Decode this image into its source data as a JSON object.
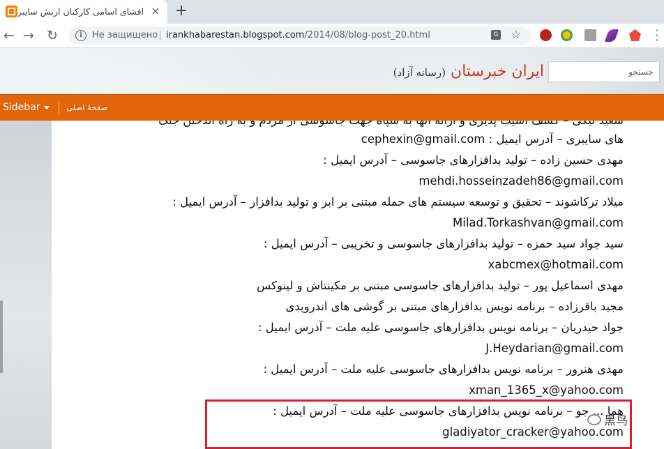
{
  "browser": {
    "tab_title": "افشای اسامی کارکنان ارتش سایبری",
    "tab_close": "×",
    "new_tab": "+",
    "not_secure_label": "Не защищено",
    "url_host": "irankhabarestan.blogspot.com",
    "url_path": "/2014/08/blog-post_20.html",
    "icons": [
      "blogger-favicon-icon",
      "back-arrow-icon",
      "forward-arrow-icon",
      "reload-icon",
      "info-icon",
      "translate-icon",
      "star-icon",
      "menu-icon"
    ]
  },
  "header": {
    "search_placeholder": "جستجو",
    "site_title": "ایران خبرستان",
    "site_subtitle": "(رسانه آزاد)"
  },
  "nav": {
    "sidebar_label": "Sidebar",
    "home_label": "صفحهٔ اصلی"
  },
  "content": {
    "lines": [
      {
        "text": "سعید لیکی – کشف آسیب پذیری و ارائه آنها به سپاه جهت جاسوسی از مردم و به راه اندختن جنگ",
        "type": "fa"
      },
      {
        "text": "های سایبری – آدرس ایمیل : cephexin@gmail.com",
        "type": "fa"
      },
      {
        "text": "مهدی حسین زاده –  تولید بدافزارهای جاسوسی – آدرس ایمیل :",
        "type": "fa"
      },
      {
        "text": "mehdi.hosseinzadeh86@gmail.com",
        "type": "em"
      },
      {
        "text": "میلاد ترکاشوند – تحقیق و توسعه سیستم های حمله مبتنی بر ابر و تولید بدافزار – آدرس ایمیل :",
        "type": "fa"
      },
      {
        "text": "Milad.Torkashvan@gmail.com",
        "type": "em"
      },
      {
        "text": "سید جواد سید حمزه – تولید بدافزارهای جاسوسی و تخریبی – آدرس ایمیل :",
        "type": "fa"
      },
      {
        "text": "xabcmex@hotmail.com",
        "type": "em"
      },
      {
        "text": "مهدی اسماعیل پور – تولید بدافزارهای جاسوسی مبتنی بر مکینتاش و لینوکس",
        "type": "fa"
      },
      {
        "text": "مجید باقرزاده – برنامه نویس بدافزارهای مبتنی بر گوشی های اندرویدی",
        "type": "fa"
      },
      {
        "text": "جواد حیدریان – برنامه نویس بدافزارهای جاسوسی علیه ملت – آدرس ایمیل :",
        "type": "fa"
      },
      {
        "text": "J.Heydarian@gmail.com",
        "type": "em"
      },
      {
        "text": "مهدی هنرور – برنامه نویس بدافزارهای جاسوسی علیه ملت – آدرس ایمیل :",
        "type": "fa"
      },
      {
        "text": "xman_1365_x@yahoo.com",
        "type": "em"
      },
      {
        "text": "هما ... جو – برنامه نویس بدافزارهای جاسوسی علیه ملت – آدرس ایمیل :",
        "type": "fa"
      },
      {
        "text": "gladiyator_cracker@yahoo.com",
        "type": "em"
      }
    ]
  },
  "watermark": {
    "text": "黑鸟"
  },
  "colors": {
    "nav_bar": "#e2650b",
    "site_title": "#c43a2a",
    "highlight_box": "#d7202f"
  }
}
